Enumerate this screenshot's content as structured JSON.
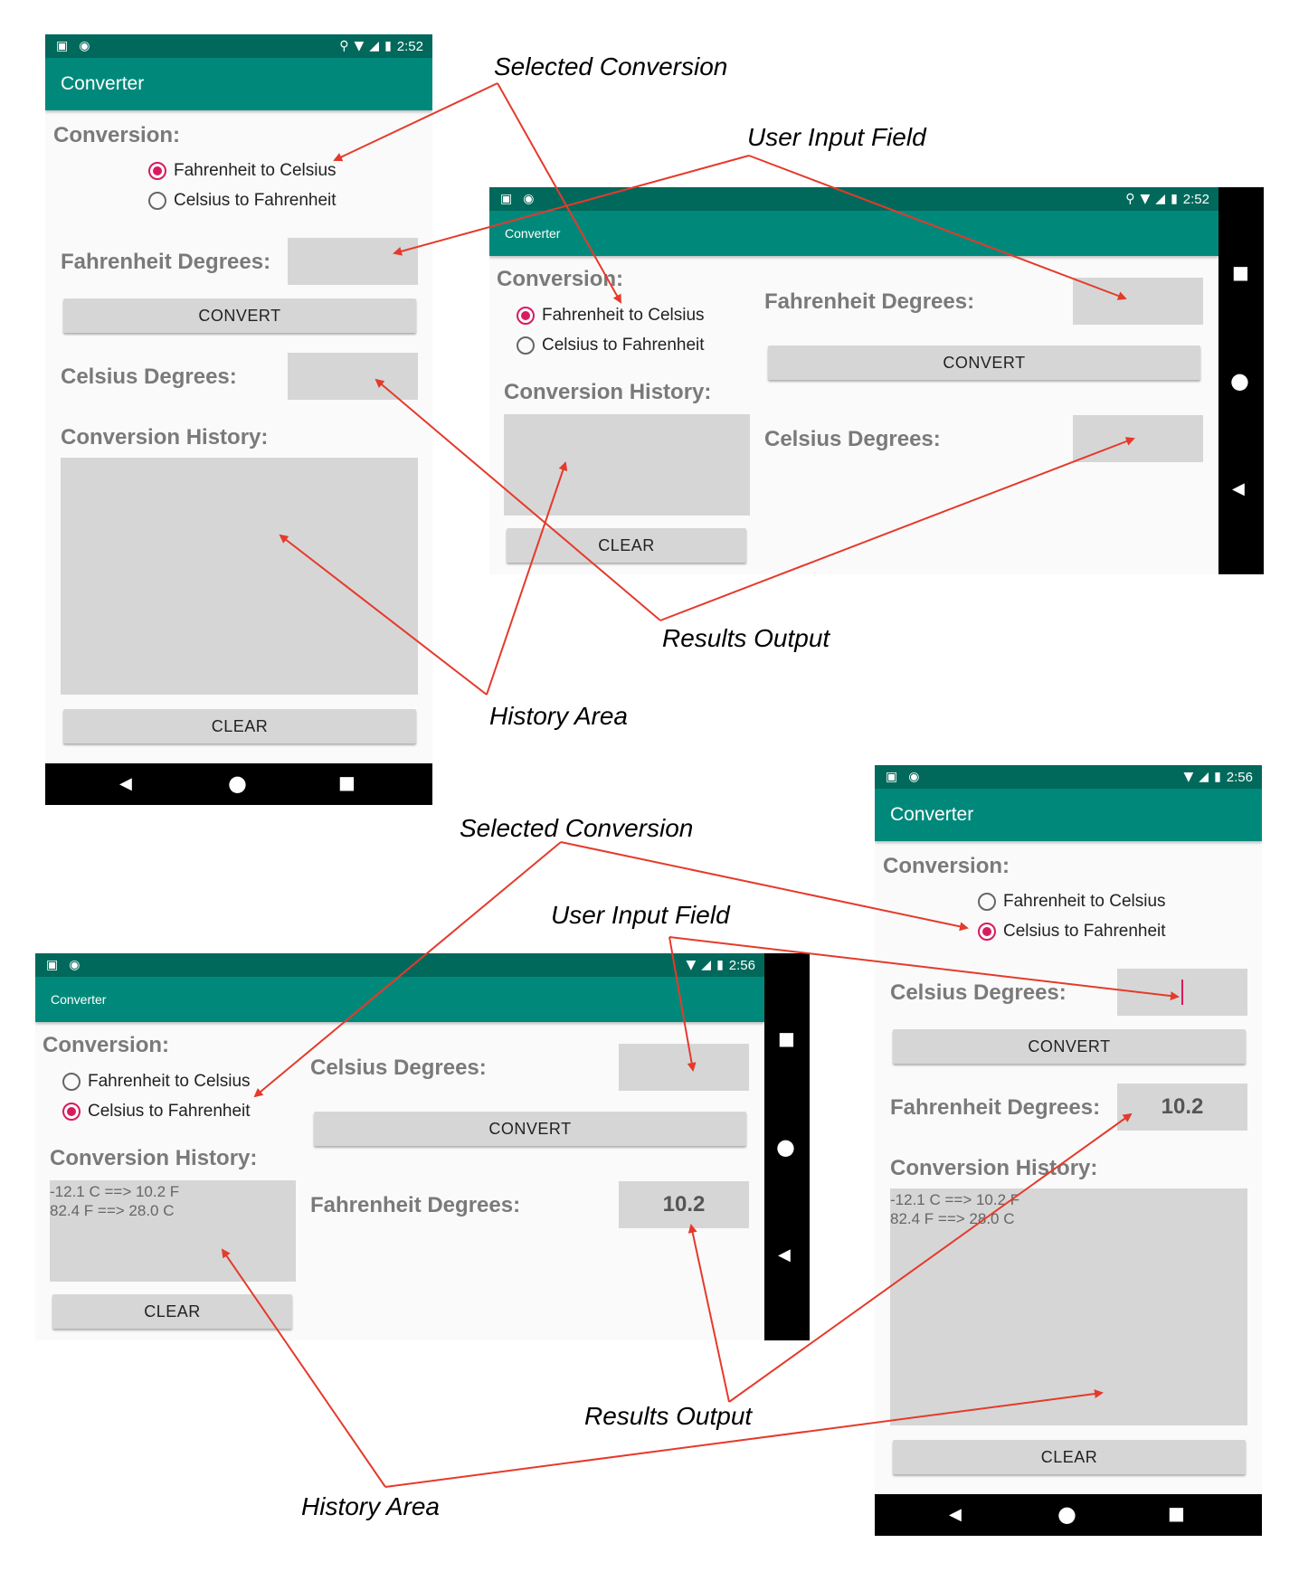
{
  "app": {
    "title": "Converter",
    "accent_color": "#00897b",
    "statusbar_color": "#00695c",
    "radio_color": "#d81b60"
  },
  "common": {
    "conversion_label": "Conversion:",
    "option_f_to_c": "Fahrenheit to Celsius",
    "option_c_to_f": "Celsius to Fahrenheit",
    "history_label": "Conversion History:",
    "convert_button": "CONVERT",
    "clear_button": "CLEAR",
    "fahrenheit_label": "Fahrenheit Degrees:",
    "celsius_label": "Celsius Degrees:",
    "statusbar_icons_left": [
      "notification-a-icon",
      "circle-icon"
    ],
    "statusbar_icons_right": [
      "location-icon",
      "wifi-icon",
      "signal-icon",
      "battery-icon"
    ]
  },
  "screen1": {
    "time": "2:52",
    "selected": "f_to_c",
    "input_value": "",
    "output_value": ""
  },
  "screen2": {
    "time": "2:52",
    "selected": "f_to_c",
    "input_value": "",
    "output_value": ""
  },
  "screen3": {
    "time": "2:56",
    "selected": "c_to_f",
    "input_value": "",
    "output_value": "10.2",
    "history": [
      "-12.1 C ==> 10.2 F",
      "82.4 F ==> 28.0 C"
    ]
  },
  "screen4": {
    "time": "2:56",
    "selected": "c_to_f",
    "input_value": "",
    "output_value": "10.2",
    "history": [
      "-12.1 C ==> 10.2 F",
      "82.4 F ==> 28.0 C"
    ]
  },
  "callouts": {
    "selected_conversion": "Selected Conversion",
    "user_input_field": "User Input Field",
    "results_output": "Results Output",
    "history_area": "History Area"
  },
  "nav_icons": [
    "back-icon",
    "home-icon",
    "recents-icon"
  ]
}
